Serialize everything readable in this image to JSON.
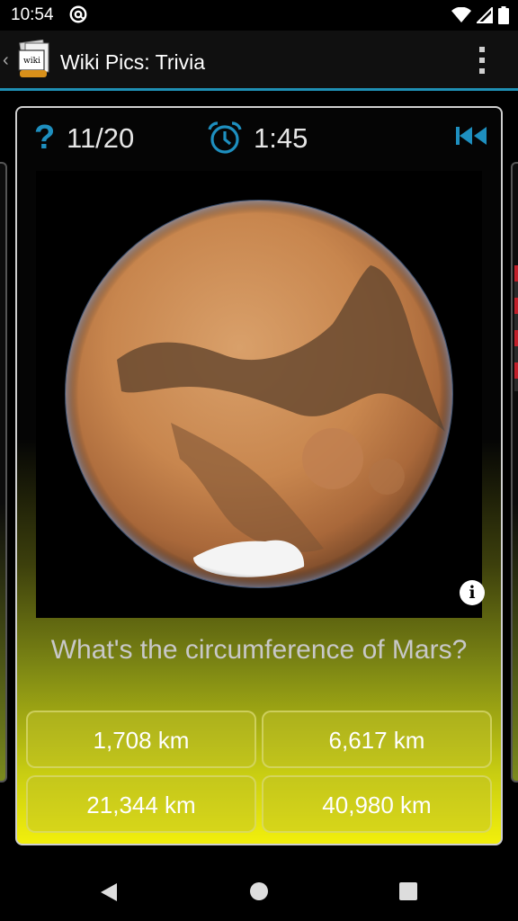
{
  "status_bar": {
    "time": "10:54",
    "icons": [
      "at-sign-icon",
      "wifi-icon",
      "cell-signal-icon",
      "battery-icon"
    ]
  },
  "app_bar": {
    "title": "Wiki Pics: Trivia",
    "app_icon_text": "wiki",
    "menu_icon": "overflow-menu-icon",
    "accent_color": "#1f8fb4"
  },
  "quiz": {
    "progress": "11/20",
    "timer": "1:45",
    "image": "mars-planet-photo",
    "question": "What's the circumference of Mars?",
    "answers": [
      {
        "label": "1,708 km"
      },
      {
        "label": "6,617 km"
      },
      {
        "label": "21,344 km"
      },
      {
        "label": "40,980 km"
      }
    ]
  },
  "nav_bar": {
    "icons": [
      "back-triangle-icon",
      "home-circle-icon",
      "recents-square-icon"
    ]
  },
  "colors": {
    "icon_blue": "#1e8fbf",
    "card_bottom_yellow": "#f2ef0c"
  }
}
